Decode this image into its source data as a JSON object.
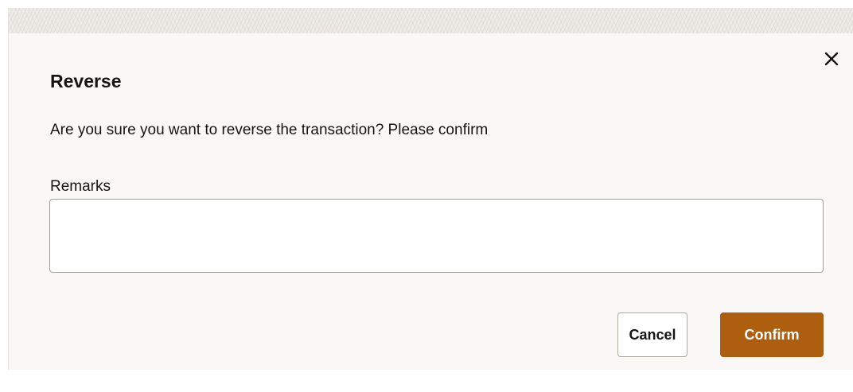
{
  "dialog": {
    "title": "Reverse",
    "message": "Are you sure you want to reverse the transaction? Please confirm",
    "remarks": {
      "label": "Remarks",
      "value": "",
      "placeholder": ""
    },
    "close_icon": "close-icon",
    "buttons": {
      "cancel_label": "Cancel",
      "confirm_label": "Confirm"
    }
  },
  "colors": {
    "dialog_background": "#f9f8f6",
    "confirm_button": "#ad5f0f",
    "text": "#161513"
  }
}
